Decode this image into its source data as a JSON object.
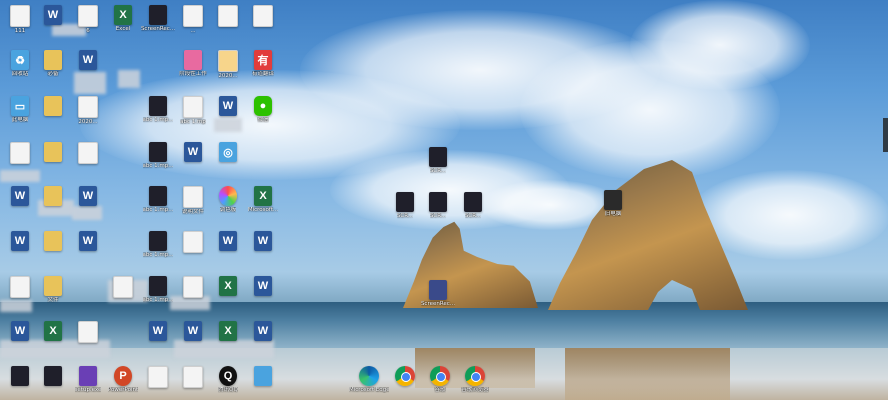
{
  "desktop": {
    "icons": [
      {
        "name": "doc-icon-1",
        "type": "doc",
        "label": "111"
      },
      {
        "name": "word-icon-1",
        "type": "word",
        "label": ""
      },
      {
        "name": "sheet-icon-1",
        "type": "doc",
        "label": "6"
      },
      {
        "name": "excel-icon-1",
        "type": "excel",
        "label": "Excel"
      },
      {
        "name": "screenrec-icon-1",
        "type": "img",
        "label": "ScreenRec..."
      },
      {
        "name": "doc-icon-2",
        "type": "doc",
        "label": "..."
      },
      {
        "name": "doc-icon-3",
        "type": "doc",
        "label": ""
      },
      {
        "name": "doc-icon-4",
        "type": "doc",
        "label": ""
      },
      {
        "name": "recycle-icon",
        "type": "net",
        "label": "回收站"
      },
      {
        "name": "folder-icon-1",
        "type": "folder",
        "label": "必备"
      },
      {
        "name": "word-icon-2",
        "type": "word",
        "label": ""
      },
      {
        "name": "app-icon-1",
        "type": "app",
        "label": "阶段性工作"
      },
      {
        "name": "doc-icon-5",
        "type": "doc",
        "label": "2020..."
      },
      {
        "name": "youdao-icon",
        "type": "app",
        "label": "有道翻译"
      },
      {
        "name": "pc-icon",
        "type": "net",
        "label": "此电脑"
      },
      {
        "name": "folder-icon-2",
        "type": "folder",
        "label": ""
      },
      {
        "name": "doc-icon-6",
        "type": "doc",
        "label": "2020..."
      },
      {
        "name": "img-icon-1",
        "type": "img",
        "label": "abc 1.mp..."
      },
      {
        "name": "doc-icon-7",
        "type": "doc",
        "label": "abc 1.mp"
      },
      {
        "name": "word-icon-3",
        "type": "word",
        "label": ""
      },
      {
        "name": "wechat-icon",
        "type": "wechat",
        "label": "微信"
      },
      {
        "name": "doc-icon-8",
        "type": "doc",
        "label": ""
      },
      {
        "name": "folder-icon-3",
        "type": "folder",
        "label": ""
      },
      {
        "name": "doc-icon-9",
        "type": "doc",
        "label": ""
      },
      {
        "name": "img-icon-2",
        "type": "img",
        "label": "abc 1.mp..."
      },
      {
        "name": "word-icon-4",
        "type": "word",
        "label": ""
      },
      {
        "name": "net-icon-1",
        "type": "net",
        "label": ""
      },
      {
        "name": "word-icon-5",
        "type": "word",
        "label": ""
      },
      {
        "name": "folder-icon-4",
        "type": "folder",
        "label": ""
      },
      {
        "name": "word-icon-6",
        "type": "word",
        "label": ""
      },
      {
        "name": "img-icon-3",
        "type": "img",
        "label": "abc 1.mp..."
      },
      {
        "name": "doc-icon-10",
        "type": "doc",
        "label": "说明文件"
      },
      {
        "name": "color-icon",
        "type": "color",
        "label": "调色板"
      },
      {
        "name": "excel-icon-2",
        "type": "excel",
        "label": "Microsoft..."
      },
      {
        "name": "word-icon-7",
        "type": "word",
        "label": ""
      },
      {
        "name": "folder-icon-5",
        "type": "folder",
        "label": ""
      },
      {
        "name": "word-icon-8",
        "type": "word",
        "label": ""
      },
      {
        "name": "img-icon-4",
        "type": "img",
        "label": "abc 1.mp..."
      },
      {
        "name": "doc-icon-11",
        "type": "doc",
        "label": ""
      },
      {
        "name": "word-icon-9",
        "type": "word",
        "label": ""
      },
      {
        "name": "word-icon-10",
        "type": "word",
        "label": ""
      },
      {
        "name": "doc-icon-12",
        "type": "doc",
        "label": ""
      },
      {
        "name": "folder-icon-6",
        "type": "folder",
        "label": "文件"
      },
      {
        "name": "doc-icon-13",
        "type": "doc",
        "label": ""
      },
      {
        "name": "img-icon-5",
        "type": "img",
        "label": "abc 1.mp..."
      },
      {
        "name": "doc-icon-14",
        "type": "doc",
        "label": ""
      },
      {
        "name": "excel-icon-3",
        "type": "excel",
        "label": ""
      },
      {
        "name": "word-icon-11",
        "type": "word",
        "label": ""
      },
      {
        "name": "word-icon-12",
        "type": "word",
        "label": ""
      },
      {
        "name": "excel-icon-4",
        "type": "excel",
        "label": ""
      },
      {
        "name": "doc-icon-15",
        "type": "doc",
        "label": ""
      },
      {
        "name": "word-icon-13",
        "type": "word",
        "label": ""
      },
      {
        "name": "word-icon-14",
        "type": "word",
        "label": ""
      },
      {
        "name": "excel-icon-5",
        "type": "excel",
        "label": ""
      },
      {
        "name": "word-icon-15",
        "type": "word",
        "label": ""
      },
      {
        "name": "img-icon-6",
        "type": "img",
        "label": ""
      },
      {
        "name": "img-icon-7",
        "type": "img",
        "label": ""
      },
      {
        "name": "game-icon",
        "type": "img",
        "label": "setup.exe"
      },
      {
        "name": "ppt-icon",
        "type": "ppt",
        "label": "PowerPoint"
      },
      {
        "name": "doc-icon-16",
        "type": "doc",
        "label": ""
      },
      {
        "name": "doc-icon-17",
        "type": "doc",
        "label": ""
      },
      {
        "name": "qq-icon",
        "type": "qq",
        "label": "腾讯QQ"
      },
      {
        "name": "net-icon-2",
        "type": "net",
        "label": ""
      },
      {
        "name": "img-icon-8",
        "type": "img",
        "label": "SCR..."
      },
      {
        "name": "img-icon-9",
        "type": "img",
        "label": "SCR..."
      },
      {
        "name": "img-icon-10",
        "type": "img",
        "label": "SCR..."
      },
      {
        "name": "img-icon-11",
        "type": "img",
        "label": "SCR..."
      },
      {
        "name": "screenrec-icon-2",
        "type": "img",
        "label": "ScreenRec..."
      },
      {
        "name": "pc-icon-2",
        "type": "img",
        "label": "旧电脑"
      },
      {
        "name": "edge-icon",
        "type": "edge",
        "label": "Microsoft Edge"
      },
      {
        "name": "chrome-icon-1",
        "type": "chrome",
        "label": ""
      },
      {
        "name": "chrome-icon-2",
        "type": "chrome",
        "label": "谷歌"
      },
      {
        "name": "chrome-icon-3",
        "type": "chrome",
        "label": "谷歌浏览器"
      }
    ]
  }
}
